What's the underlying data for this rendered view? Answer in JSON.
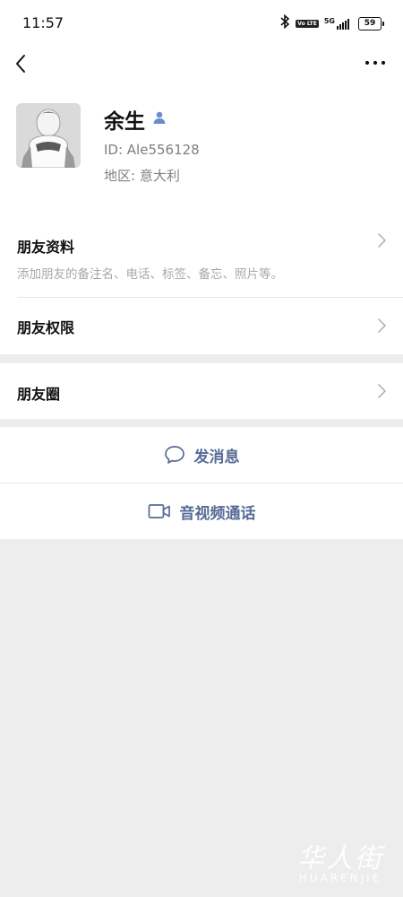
{
  "status_bar": {
    "time": "11:57",
    "network": "5G",
    "volte": "Vo LTE",
    "battery": "59"
  },
  "profile": {
    "name": "余生",
    "wechat_id": "ID:  Ale556128",
    "region": "地区:  意大利",
    "avatar_icon": "user-photo",
    "badge_icon": "person-badge-icon"
  },
  "sections": {
    "info_title": "朋友资料",
    "info_sub": "添加朋友的备注名、电话、标签、备忘、照片等。",
    "permissions_title": "朋友权限",
    "moments_title": "朋友圈"
  },
  "actions": {
    "send_message": "发消息",
    "video_call": "音视频通话"
  },
  "colors": {
    "accent": "#576b95",
    "background": "#ededed",
    "badge": "#6b8ccf"
  },
  "watermark": {
    "cn": "华人街",
    "en": "HUARENJIE"
  }
}
